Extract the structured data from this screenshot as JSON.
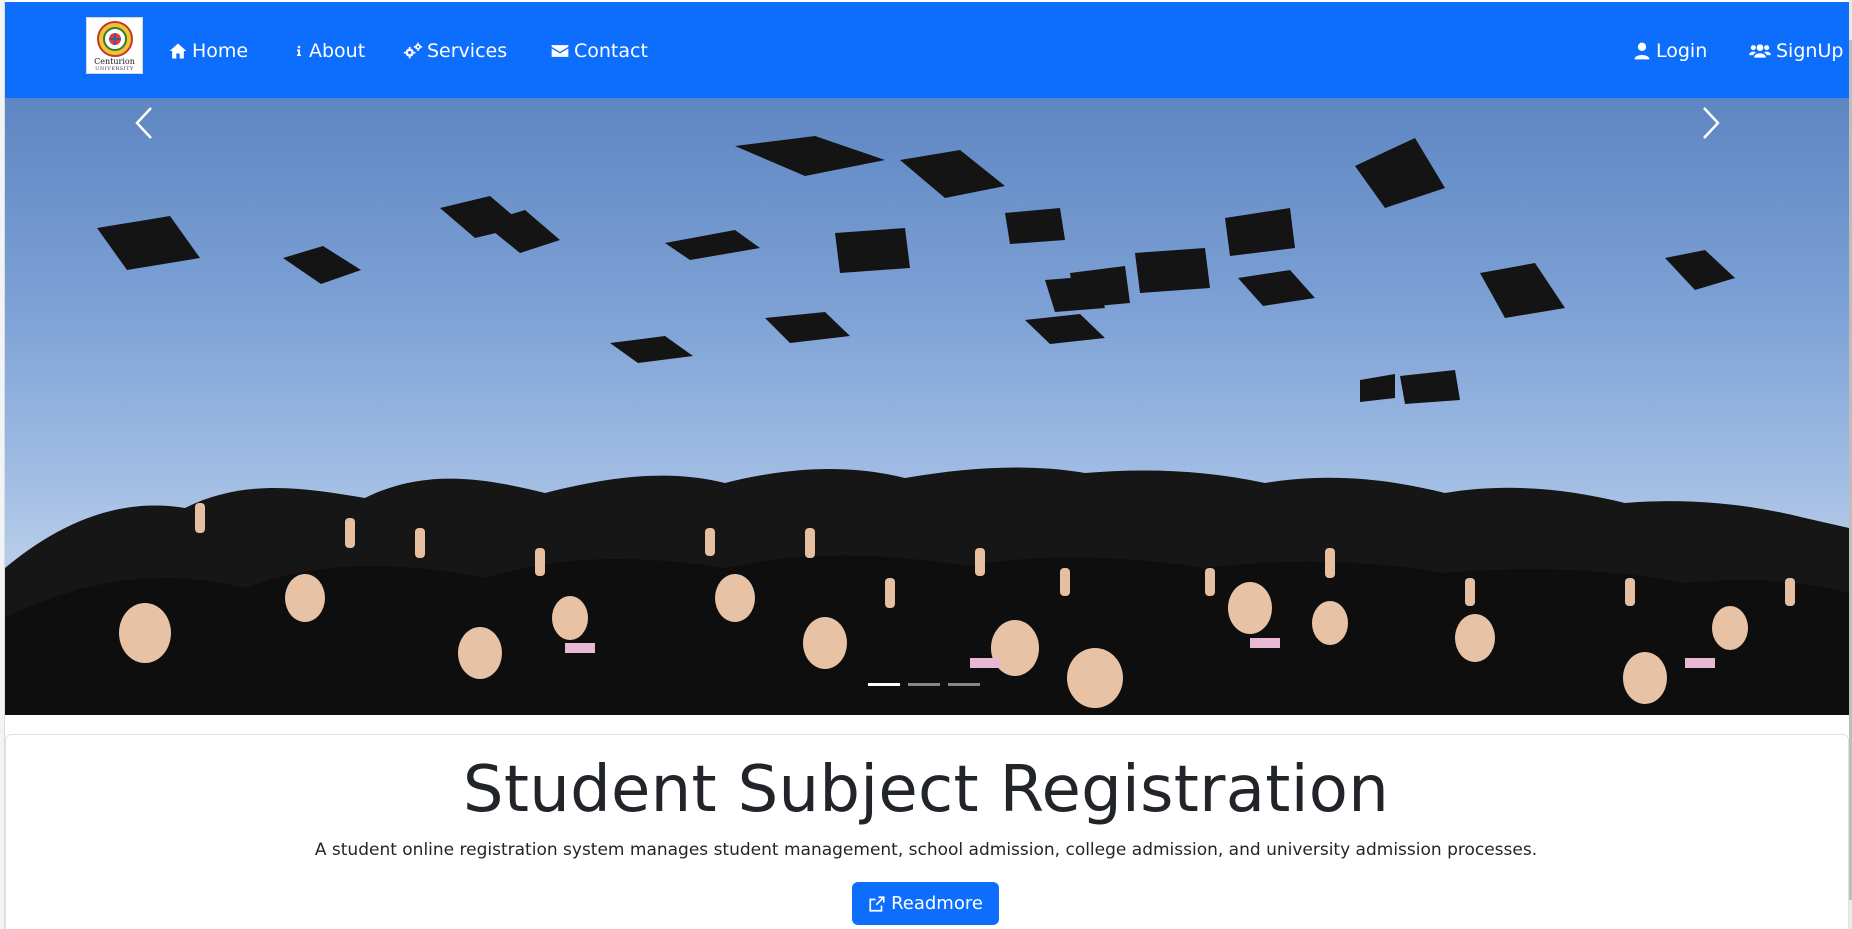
{
  "navbar": {
    "logo": {
      "name": "Centurion",
      "sub": "UNIVERSITY"
    },
    "links": {
      "home": "Home",
      "about": "About",
      "services": "Services",
      "contact": "Contact"
    },
    "right": {
      "login": "Login",
      "signup": "SignUp"
    },
    "icons": {
      "home": "home-icon",
      "about": "info-icon",
      "services": "gears-icon",
      "contact": "envelope-icon",
      "login": "user-icon",
      "signup": "users-icon"
    }
  },
  "carousel": {
    "slide_count": 3,
    "active_slide": 0,
    "image_subject": "graduates-throwing-caps"
  },
  "hero": {
    "title": "Student Subject Registration",
    "description": "A student online registration system manages student management, school admission, college admission, and university admission processes.",
    "button_label": "Readmore",
    "button_icon": "external-link-icon"
  },
  "colors": {
    "primary": "#0d6efd",
    "text": "#212529",
    "white": "#ffffff"
  }
}
